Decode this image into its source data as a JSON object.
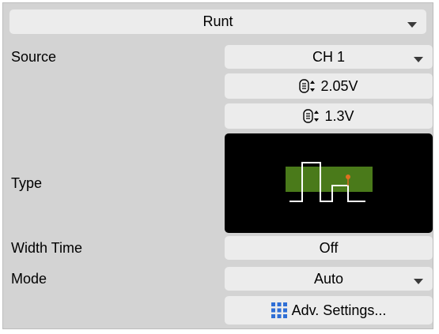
{
  "trigger_type_dropdown": {
    "value": "Runt"
  },
  "source": {
    "label": "Source",
    "value": "CH 1"
  },
  "upper_threshold": {
    "value": "2.05V",
    "icon": "knob-icon"
  },
  "lower_threshold": {
    "value": "1.3V",
    "icon": "knob-icon"
  },
  "type": {
    "label": "Type",
    "icon": "runt-pulse-icon"
  },
  "width_time": {
    "label": "Width Time",
    "value": "Off"
  },
  "mode": {
    "label": "Mode",
    "value": "Auto"
  },
  "adv_settings": {
    "label": "Adv. Settings...",
    "icon": "grid-icon"
  },
  "colors": {
    "panel_bg": "#d3d3d3",
    "button_bg": "#ececec",
    "waveform_fill": "#4a7a1a",
    "waveform_line": "#ffffff",
    "marker": "#e07020",
    "grid_icon": "#2f6fd6"
  }
}
